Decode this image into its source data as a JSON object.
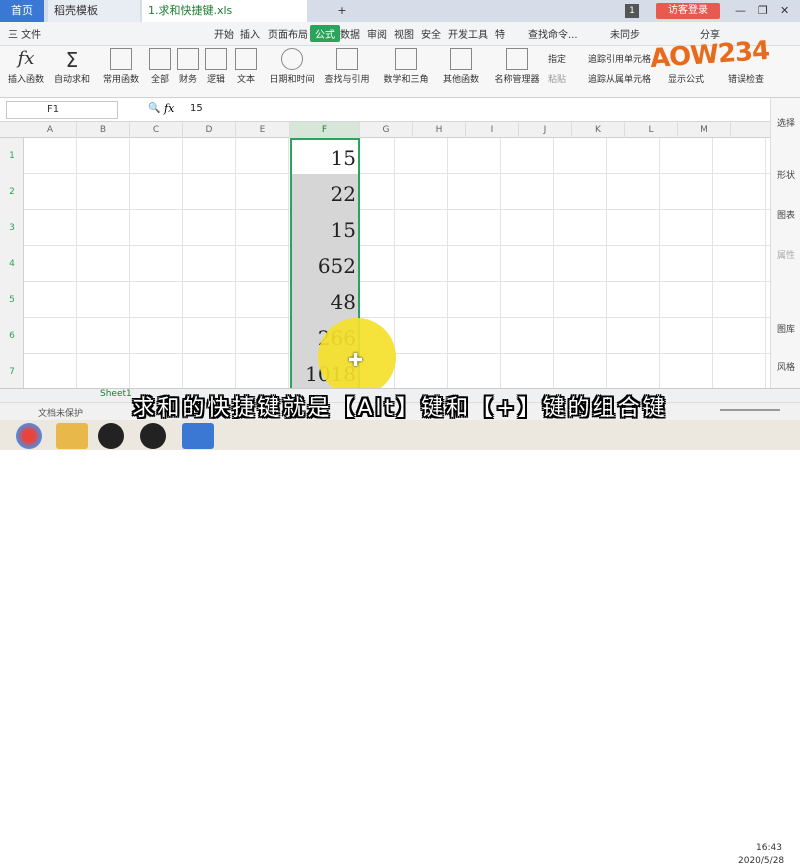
{
  "tabs": {
    "home": "首页",
    "template": "稻壳模板",
    "file": "1.求和快捷键.xls",
    "tab_count": "1",
    "guest_login": "访客登录"
  },
  "menu": {
    "file": "三 文件",
    "items": [
      "开始",
      "插入",
      "页面布局",
      "公式",
      "数据",
      "审阅",
      "视图",
      "安全",
      "开发工具",
      "特"
    ],
    "search": "查找命令...",
    "unsynced": "未同步",
    "share": "分享"
  },
  "ribbon": {
    "buttons": [
      "插入函数",
      "自动求和",
      "常用函数",
      "全部",
      "财务",
      "逻辑",
      "文本",
      "日期和时间",
      "查找与引用",
      "数学和三角",
      "其他函数",
      "名称管理器"
    ],
    "right": [
      "指定",
      "粘贴",
      "追踪引用单元格",
      "追踪从属单元格",
      "显示公式",
      "错误检查"
    ]
  },
  "formula_bar": {
    "name_box": "F1",
    "fx": "fx",
    "value": "15"
  },
  "columns": [
    "A",
    "B",
    "C",
    "D",
    "E",
    "F",
    "G",
    "H",
    "I",
    "J",
    "K",
    "L",
    "M"
  ],
  "rows": [
    "1",
    "2",
    "3",
    "4",
    "5",
    "6",
    "7"
  ],
  "cells_f": [
    "15",
    "22",
    "15",
    "652",
    "48",
    "266",
    "1018"
  ],
  "right_panel": [
    "选择",
    "形状",
    "图表",
    "属性",
    "图库",
    "风格"
  ],
  "sheet": {
    "name": "Sheet1",
    "unsaved": "文档未保护"
  },
  "caption": "求和的快捷键就是【Alt】键和【+】键的组合键",
  "watermark": "AOW234",
  "taskbar": {
    "time": "16:43",
    "date": "2020/5/28"
  }
}
